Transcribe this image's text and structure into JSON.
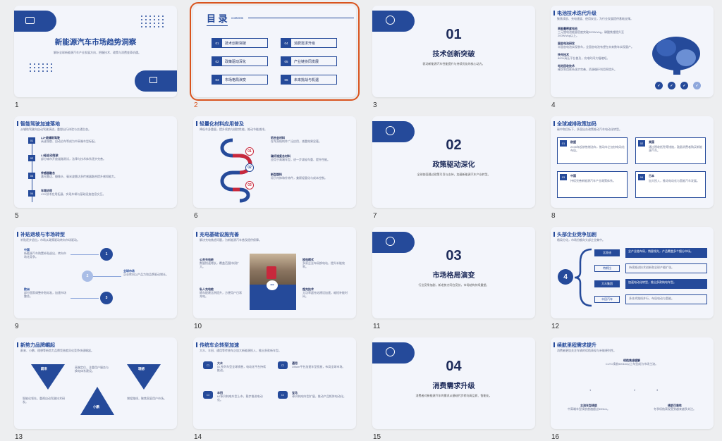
{
  "slides": [
    {
      "num": "1",
      "title": "新能源汽车市场趋势洞察",
      "subtitle": "解析全球新能源汽车产业发展方向，把握技术、政策与消费变革机遇。"
    },
    {
      "num": "2",
      "toc_title": "目 录",
      "toc_sub": "contents",
      "items": [
        {
          "n": "01",
          "t": "技术创新突破"
        },
        {
          "n": "04",
          "t": "消费需求升级"
        },
        {
          "n": "02",
          "t": "政策驱动深化"
        },
        {
          "n": "05",
          "t": "产业链协同发展"
        },
        {
          "n": "03",
          "t": "市场格局演变"
        },
        {
          "n": "06",
          "t": "未来挑战与机遇"
        }
      ]
    },
    {
      "num": "3",
      "big": "01",
      "title": "技术创新突破",
      "desc": "驱动新能源汽车性能提升与持续优化的核心动力。"
    },
    {
      "num": "4",
      "title": "电池技术迭代升级",
      "sub": "聚焦续航、充电速度、使用安全，为行业发展提供基础支撑。",
      "items": [
        {
          "h": "高能量密度电池",
          "d": "三元锂电池能量密度突破300Wh/kg，磷酸铁锂提升至200Wh/kg以上。"
        },
        {
          "h": "固态电池研发",
          "d": "半固态电池实现装车，全固态电池有望在未来数年实现量产。"
        },
        {
          "h": "快充技术",
          "d": "800V高压平台普及，充电时间大幅缩短。"
        },
        {
          "h": "电池回收技术",
          "d": "梯次利用体系逐步完善，资源循环利用率提升。"
        }
      ]
    },
    {
      "num": "5",
      "title": "智能驾驶加速落地",
      "sub": "从辅助驾驶向自动驾驶演进，重塑出行体验与交通生态。",
      "items": [
        {
          "n": "01",
          "h": "L2+级辅助驾驶",
          "d": "高速领航、自动泊车等成为中高端车型标配。"
        },
        {
          "n": "02",
          "h": "L3级自动驾驶",
          "d": "部分城市开放道路测试，法律与技术体系逐步完善。"
        },
        {
          "n": "03",
          "h": "传感器融合",
          "d": "激光雷达、摄像头、毫米波雷达多传感器融合提升感知能力。"
        },
        {
          "n": "04",
          "h": "车路协同",
          "d": "V2X技术应用拓展，实现车辆与基础设施信息交互。"
        }
      ]
    },
    {
      "num": "6",
      "title": "轻量化材料应用普及",
      "sub": "降低车身重量，提升续航与操控性能，推动节能减排。",
      "items": [
        {
          "n": "01",
          "h": "铝合金材料",
          "d": "在车身结构件广泛应用，减重效果显著。"
        },
        {
          "n": "02",
          "h": "碳纤维复合材料",
          "d": "应用于高端车型，进一步减轻车重、提升性能。"
        },
        {
          "n": "03",
          "h": "新型塑料",
          "d": "用于内饰和外饰件，兼顾轻量化与成本控制。"
        }
      ]
    },
    {
      "num": "7",
      "big": "02",
      "title": "政策驱动深化",
      "desc": "全球各国通过政策引导与支持，加速新能源汽车产业转型。"
    },
    {
      "num": "8",
      "title": "全球减排政策加码",
      "sub": "碳中和目标下，多国出台政策推动汽车电动化转型。",
      "items": [
        {
          "n": "01",
          "h": "欧盟",
          "d": "2035年起禁售燃油车，推动车企加快电动化布局。"
        },
        {
          "n": "02",
          "h": "美国",
          "d": "通过税收抵免等措施，鼓励消费者购买新能源汽车。"
        },
        {
          "n": "03",
          "h": "中国",
          "d": "持续完善新能源汽车产业政策体系。"
        },
        {
          "n": "04",
          "h": "日本",
          "d": "加大投入，推动电动化与氢能汽车发展。"
        }
      ]
    },
    {
      "num": "9",
      "title": "补贴退坡与市场转型",
      "sub": "补贴逐步退出，市场从政策驱动转向市场驱动。",
      "items": [
        {
          "h": "中国",
          "d": "新能源汽车购置补贴退出，转向市场化竞争。"
        },
        {
          "h": "欧洲",
          "d": "部分国家调整补贴标准，加速市场整合。"
        },
        {
          "h": "全球市场",
          "d": "企业转向以产品力和品牌驱动增长。"
        }
      ]
    },
    {
      "num": "10",
      "title": "充电基础设施完善",
      "sub": "解决充电焦虑问题，为新能源汽车普及提供保障。",
      "items": [
        {
          "h": "公共充电桩",
          "d": "数量快速增长，覆盖范围持续扩大。"
        },
        {
          "h": "私人充电桩",
          "d": "随车配建比例提升，方便用户日常充电。"
        },
        {
          "h": "换电模式",
          "d": "多家企业布局换电站，提升补能效率。"
        },
        {
          "h": "超充技术",
          "d": "大功率超充站建设加速，缩短补能时间。"
        }
      ]
    },
    {
      "num": "11",
      "big": "03",
      "title": "市场格局演变",
      "desc": "行业竞争加剧，新老势力同台竞技，市场结构持续重塑。"
    },
    {
      "num": "12",
      "title": "头部企业竞争加剧",
      "sub": "格局分化，市场份额向头部企业集中。",
      "center": "4",
      "items": [
        {
          "h": "比亚迪",
          "d": "全产业链布局，销量领先，产品覆盖多个细分市场。"
        },
        {
          "h": "特斯拉",
          "d": "持续推进技术创新和全球产能扩张。"
        },
        {
          "h": "大众集团",
          "d": "加速电动化转型，推出多款纯电车型。"
        },
        {
          "h": "丰田汽车",
          "d": "多技术路线并行，布局电动与氢能。"
        }
      ]
    },
    {
      "num": "13",
      "title": "新势力品牌崛起",
      "sub": "蔚来、小鹏、理想等新势力品牌凭借差异化竞争快速崛起。",
      "items": [
        {
          "h": "蔚来",
          "d": "高端定位，注重用户服务与换电体系建设。"
        },
        {
          "h": "理想",
          "d": "增程路线，聚焦家庭用户市场。"
        },
        {
          "h": "小鹏",
          "d": "智能化领先，重视自动驾驶技术研发。"
        }
      ]
    },
    {
      "num": "14",
      "title": "传统车企转型加速",
      "sub": "大众、丰田、通用等传统车企加大新能源投入，推出多款新车型。",
      "items": [
        {
          "h": "大众",
          "d": "ID.系列车型全球销售，电动化平台持续推进。"
        },
        {
          "h": "通用",
          "d": "Ultium平台加速车型投放，布局全球市场。"
        },
        {
          "h": "丰田",
          "d": "bZ系列纯电车型上市，稳步推进电动化。"
        },
        {
          "h": "宝马",
          "d": "i系列纯电车型扩展，推动产品矩阵电动化。"
        }
      ]
    },
    {
      "num": "15",
      "big": "04",
      "title": "消费需求升级",
      "desc": "消费者对新能源汽车的需求从基础代步转向高品质、智能化。"
    },
    {
      "num": "16",
      "title": "续航里程需求提升",
      "sub": "消费者更加关注车辆的续航表现与补能便利性。",
      "items": [
        {
          "h": "续航焦虑缓解",
          "d": "CLTC续航500km以上车型成为市场主流。"
        },
        {
          "h": "主流车型续航",
          "d": "中高端车型续航普遍超过600km。"
        },
        {
          "h": "续航可靠性",
          "d": "冬季续航表现受到越来越多关注。"
        }
      ]
    }
  ],
  "colors": {
    "accent": "#254a9a",
    "selected": "#d9531e",
    "background": "#edeef0",
    "slide": "#f3f5fb"
  }
}
